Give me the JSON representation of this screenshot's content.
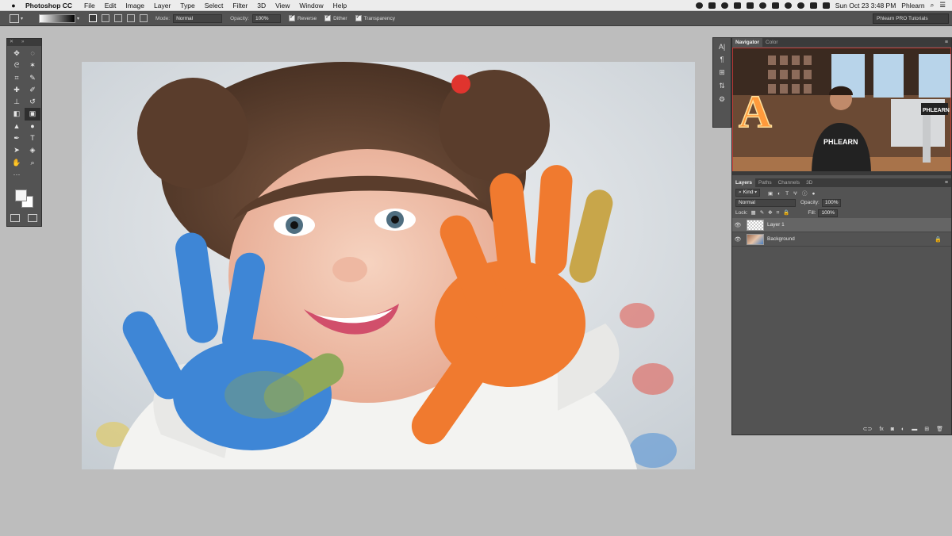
{
  "menubar": {
    "app_name": "Photoshop CC",
    "items": [
      "File",
      "Edit",
      "Image",
      "Layer",
      "Type",
      "Select",
      "Filter",
      "3D",
      "View",
      "Window",
      "Help"
    ],
    "clock": "Sun Oct 23  3:48 PM",
    "user": "Phlearn"
  },
  "options": {
    "mode_label": "Mode:",
    "mode_value": "Normal",
    "opacity_label": "Opacity:",
    "opacity_value": "100%",
    "reverse_label": "Reverse",
    "dither_label": "Dither",
    "transparency_label": "Transparency",
    "workspace": "Phlearn PRO Tutorials"
  },
  "navigator": {
    "tabs": [
      "Navigator",
      "Color"
    ],
    "logo_text": "PHLEARN",
    "shirt_text": "PHLEARN",
    "letter": "A"
  },
  "layers": {
    "tabs": [
      "Layers",
      "Paths",
      "Channels",
      "3D"
    ],
    "kind_label": "Kind",
    "blend_mode": "Normal",
    "opacity_label": "Opacity:",
    "opacity_value": "100%",
    "lock_label": "Lock:",
    "fill_label": "Fill:",
    "fill_value": "100%",
    "items": [
      {
        "name": "Layer 1",
        "selected": true
      },
      {
        "name": "Background",
        "locked": true
      }
    ],
    "footer_icons": [
      "link-icon",
      "fx-icon",
      "mask-icon",
      "adjustment-icon",
      "folder-icon",
      "new-layer-icon",
      "trash-icon"
    ]
  },
  "tools": [
    "move-tool",
    "marquee-tool",
    "lasso-tool",
    "magic-wand-tool",
    "crop-tool",
    "eyedropper-tool",
    "healing-tool",
    "brush-tool",
    "stamp-tool",
    "history-brush-tool",
    "eraser-tool",
    "gradient-tool",
    "blur-tool",
    "dodge-tool",
    "pen-tool",
    "type-tool",
    "path-select-tool",
    "shape-tool",
    "hand-tool",
    "zoom-tool",
    "more-tools"
  ]
}
